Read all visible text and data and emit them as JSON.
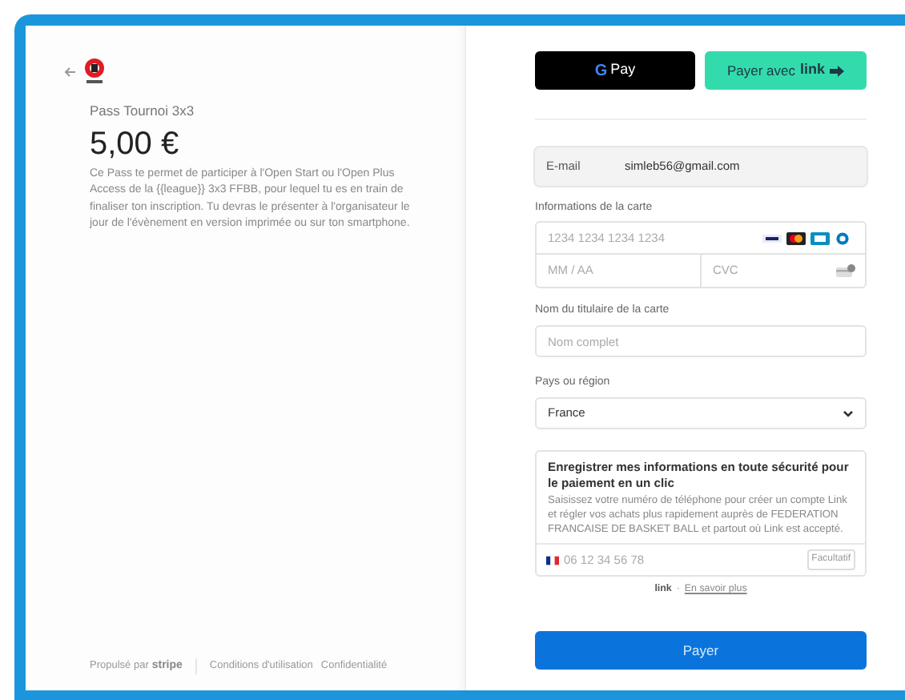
{
  "product": {
    "name": "Pass Tournoi 3x3",
    "price": "5,00 €",
    "description": "Ce Pass te permet de participer à l'Open Start ou l'Open Plus Access de la {{league}} 3x3 FFBB, pour lequel tu es en train de finaliser ton inscription. Tu devras le présenter à l'organisateur le jour de l'évènement en version imprimée ou sur ton smartphone."
  },
  "footer": {
    "powered": "Propulsé par",
    "brand": "stripe",
    "links": [
      "Conditions d'utilisation",
      "Confidentialité"
    ]
  },
  "gpay": {
    "g": "G",
    "label": "Pay"
  },
  "link_button": {
    "label": "Payer avec",
    "brand": "link"
  },
  "email": {
    "label": "E-mail",
    "value": "simleb56@gmail.com"
  },
  "card": {
    "label": "Informations de la carte",
    "number_placeholder": "1234 1234 1234 1234",
    "expiry_placeholder": "MM / AA",
    "cvc_placeholder": "CVC"
  },
  "holder": {
    "label": "Nom du titulaire de la carte",
    "placeholder": "Nom complet"
  },
  "country": {
    "label": "Pays ou région",
    "value": "France"
  },
  "save": {
    "title": "Enregistrer mes informations en toute sécurité pour le paiement en un clic",
    "text": "Saisissez votre numéro de téléphone pour créer un compte Link et régler vos achats plus rapidement auprès de FEDERATION FRANCAISE DE BASKET BALL et partout où Link est accepté.",
    "phone_placeholder": "06 12 34 56 78",
    "optional": "Facultatif"
  },
  "link_info": {
    "brand": "link",
    "separator": "·",
    "more": "En savoir plus"
  },
  "pay_button": "Payer"
}
